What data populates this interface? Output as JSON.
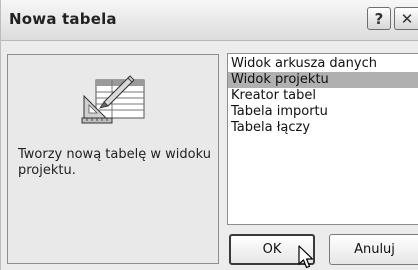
{
  "window": {
    "title": "Nowa tabela",
    "help_symbol": "?",
    "close_symbol": "✕"
  },
  "preview": {
    "icon": "table-design-icon",
    "description": "Tworzy nową tabelę w widoku projektu."
  },
  "list": {
    "items": [
      "Widok arkusza danych",
      "Widok projektu",
      "Kreator tabel",
      "Tabela importu",
      "Tabela łączy"
    ],
    "selected": "Widok projektu"
  },
  "buttons": {
    "ok_label": "OK",
    "cancel_label": "Anuluj"
  },
  "colors": {
    "selection": "#b0b0b0",
    "dialog_background": "#ececec"
  }
}
